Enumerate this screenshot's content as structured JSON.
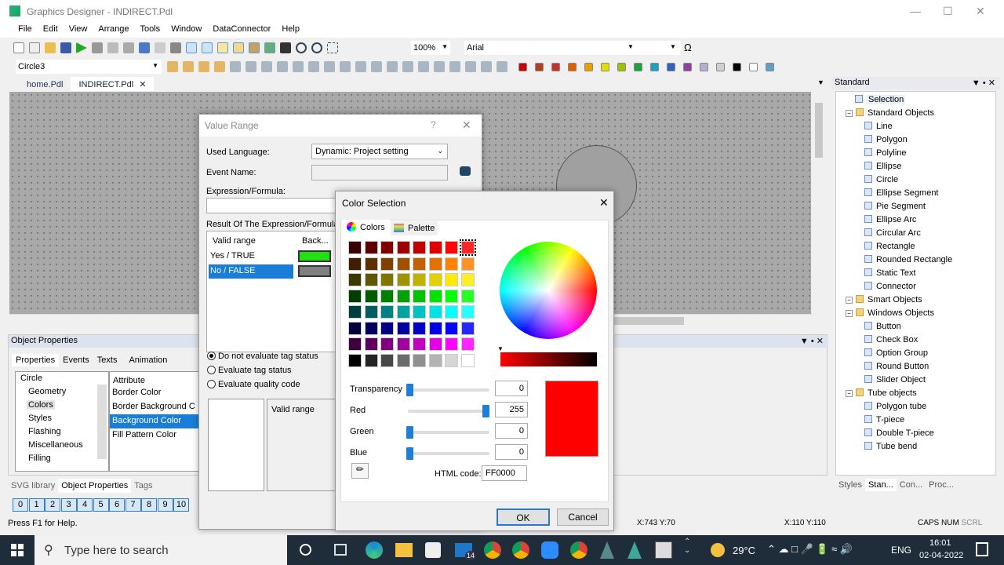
{
  "window": {
    "title": "Graphics Designer - INDIRECT.Pdl"
  },
  "menu": [
    "File",
    "Edit",
    "View",
    "Arrange",
    "Tools",
    "Window",
    "DataConnector",
    "Help"
  ],
  "toolbar": {
    "zoom": "100%",
    "font": "Arial",
    "object_selector": "Circle3"
  },
  "doc_tabs": [
    "home.Pdl",
    "INDIRECT.Pdl"
  ],
  "right_panel": {
    "title": "Standard",
    "items": [
      {
        "label": "Selection",
        "level": 0,
        "selected": true
      },
      {
        "label": "Standard Objects",
        "level": 0,
        "folder": true
      },
      {
        "label": "Line",
        "level": 1
      },
      {
        "label": "Polygon",
        "level": 1
      },
      {
        "label": "Polyline",
        "level": 1
      },
      {
        "label": "Ellipse",
        "level": 1
      },
      {
        "label": "Circle",
        "level": 1
      },
      {
        "label": "Ellipse Segment",
        "level": 1
      },
      {
        "label": "Pie Segment",
        "level": 1
      },
      {
        "label": "Ellipse Arc",
        "level": 1
      },
      {
        "label": "Circular Arc",
        "level": 1
      },
      {
        "label": "Rectangle",
        "level": 1
      },
      {
        "label": "Rounded Rectangle",
        "level": 1
      },
      {
        "label": "Static Text",
        "level": 1
      },
      {
        "label": "Connector",
        "level": 1
      },
      {
        "label": "Smart Objects",
        "level": 0,
        "folder": true
      },
      {
        "label": "Windows Objects",
        "level": 0,
        "folder": true
      },
      {
        "label": "Button",
        "level": 1
      },
      {
        "label": "Check Box",
        "level": 1
      },
      {
        "label": "Option Group",
        "level": 1
      },
      {
        "label": "Round Button",
        "level": 1
      },
      {
        "label": "Slider Object",
        "level": 1
      },
      {
        "label": "Tube objects",
        "level": 0,
        "folder": true
      },
      {
        "label": "Polygon tube",
        "level": 1
      },
      {
        "label": "T-piece",
        "level": 1
      },
      {
        "label": "Double T-piece",
        "level": 1
      },
      {
        "label": "Tube bend",
        "level": 1
      }
    ],
    "bottom_tabs": [
      "Styles",
      "Stan...",
      "Con...",
      "Proc..."
    ]
  },
  "object_properties": {
    "title": "Object Properties",
    "tabs": [
      "Properties",
      "Events",
      "Texts",
      "Animation"
    ],
    "tree": [
      "Circle",
      "Geometry",
      "Colors",
      "Styles",
      "Flashing",
      "Miscellaneous",
      "Filling"
    ],
    "attr_header": "Attribute",
    "attributes": [
      "Border Color",
      "Border Background C",
      "Background Color",
      "Fill Pattern Color"
    ]
  },
  "bottom_tabs": [
    "SVG library",
    "Object Properties",
    "Tags"
  ],
  "layers": [
    "0",
    "1",
    "2",
    "3",
    "4",
    "5",
    "6",
    "7",
    "8",
    "9",
    "10"
  ],
  "status": {
    "help": "Press F1 for Help.",
    "position": "X:743 Y:70",
    "size": "X:110 Y:110",
    "caps": "CAPS",
    "num": "NUM",
    "scrl": "SCRL"
  },
  "value_range": {
    "title": "Value Range",
    "used_language_label": "Used Language:",
    "used_language": "Dynamic: Project setting",
    "event_name_label": "Event Name:",
    "event_name": "",
    "expression_label": "Expression/Formula:",
    "expression": "",
    "result_label": "Result Of The Expression/Formula:",
    "col_valid": "Valid range",
    "col_back": "Back...",
    "rows": [
      {
        "label": "Yes / TRUE",
        "color": "#22e010"
      },
      {
        "label": "No / FALSE",
        "color": "#808080"
      }
    ],
    "radios": [
      {
        "label": "Do not evaluate tag status",
        "checked": true
      },
      {
        "label": "Evaluate tag status",
        "checked": false
      },
      {
        "label": "Evaluate quality code",
        "checked": false
      }
    ],
    "lower_col": "Valid range"
  },
  "color_selection": {
    "title": "Color Selection",
    "tabs": [
      "Colors",
      "Palette"
    ],
    "swatch_hues": [
      0,
      30,
      55,
      120,
      180,
      240,
      300,
      -1
    ],
    "transparency_label": "Transparency",
    "transparency": "0",
    "red_label": "Red",
    "red": "255",
    "green_label": "Green",
    "green": "0",
    "blue_label": "Blue",
    "blue": "0",
    "html_code_label": "HTML code:",
    "html_code": "FF0000",
    "preview": "#ff0000",
    "ok": "OK",
    "cancel": "Cancel"
  },
  "taskbar": {
    "search": "Type here to search",
    "weather": "29°C",
    "lang": "ENG",
    "time": "16:01",
    "date": "02-04-2022",
    "mail_badge": "14"
  }
}
